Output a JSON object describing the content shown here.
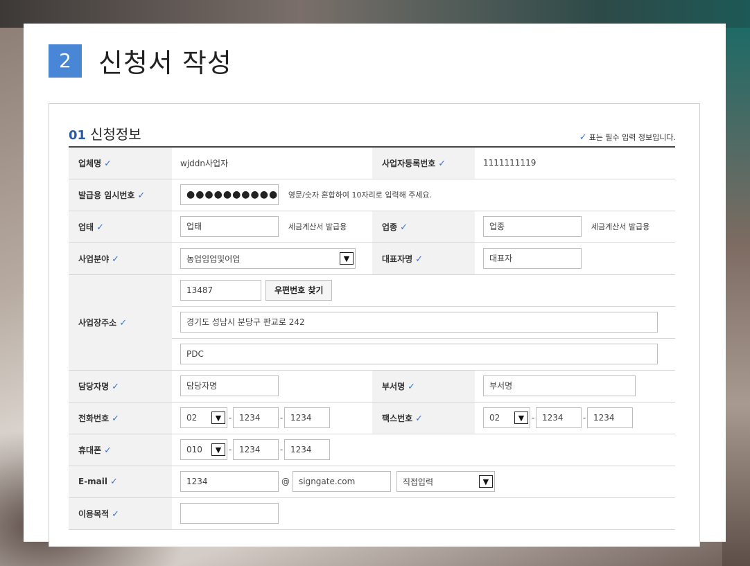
{
  "step": {
    "number": "2",
    "title": "신청서 작성"
  },
  "section": {
    "number": "01",
    "title": "신청정보",
    "required_note": "표는 필수 입력 정보입니다."
  },
  "check_mark": "✓",
  "labels": {
    "company_name": "업체명",
    "biz_reg_no": "사업자등록번호",
    "temp_password": "발급용 임시번호",
    "biz_type": "업태",
    "biz_item": "업종",
    "biz_field": "사업분야",
    "ceo_name": "대표자명",
    "address": "사업장주소",
    "manager_name": "담당자명",
    "department": "부서명",
    "phone": "전화번호",
    "fax": "팩스번호",
    "mobile": "휴대폰",
    "email": "E-mail",
    "purpose": "이용목적"
  },
  "values": {
    "company_name": "wjddn사업자",
    "biz_reg_no": "1111111119",
    "temp_password_mask": "●●●●●●●●●●",
    "temp_password_hint": "영문/숫자 혼합하여 10자리로 입력해 주세요.",
    "biz_type_placeholder": "업태",
    "biz_type_hint": "세금계산서 발급용",
    "biz_item_placeholder": "업종",
    "biz_item_hint": "세금계산서 발급용",
    "biz_field_selected": "농업임업및어업",
    "ceo_placeholder": "대표자",
    "zipcode": "13487",
    "zipcode_button": "우편번호 찾기",
    "address1": "경기도 성남시 분당구 판교로 242",
    "address2": "PDC",
    "manager_placeholder": "담당자명",
    "department_placeholder": "부서명",
    "phone": [
      "02",
      "1234",
      "1234"
    ],
    "fax": [
      "02",
      "1234",
      "1234"
    ],
    "mobile": [
      "010",
      "1234",
      "1234"
    ],
    "email_id": "1234",
    "email_at": "@",
    "email_domain": "signgate.com",
    "email_domain_select": "직접입력",
    "purpose": "",
    "dash": "-"
  },
  "colors": {
    "accent": "#4a86d6",
    "section_number": "#2b5aa8",
    "check": "#3d73c9"
  }
}
